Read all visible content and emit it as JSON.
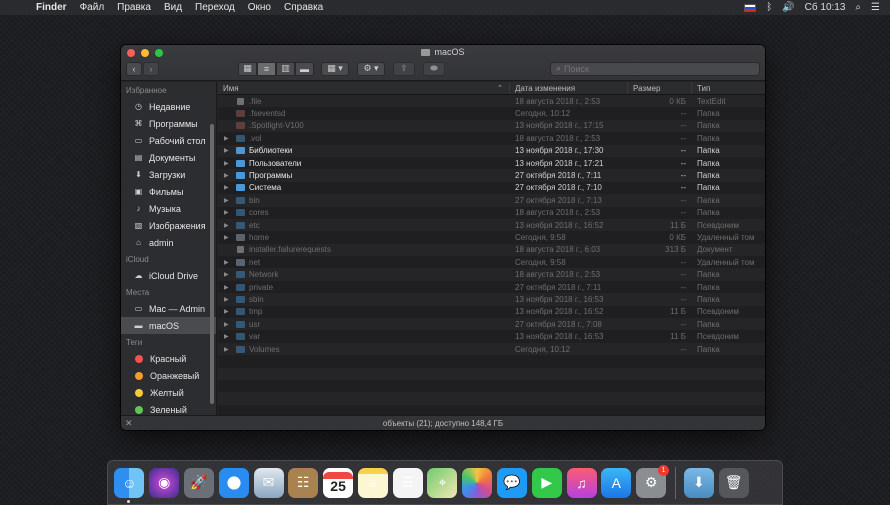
{
  "menubar": {
    "items": [
      "Finder",
      "Файл",
      "Правка",
      "Вид",
      "Переход",
      "Окно",
      "Справка"
    ],
    "clock": "Сб 10:13"
  },
  "window": {
    "title": "macOS",
    "search_placeholder": "Поиск",
    "status": "объекты (21); доступно 148,4 ГБ"
  },
  "sidebar": {
    "favorites_header": "Избранное",
    "favorites": [
      {
        "label": "Недавние",
        "icon": "recents-icon"
      },
      {
        "label": "Программы",
        "icon": "applications-icon"
      },
      {
        "label": "Рабочий стол",
        "icon": "desktop-icon"
      },
      {
        "label": "Документы",
        "icon": "documents-icon"
      },
      {
        "label": "Загрузки",
        "icon": "downloads-icon"
      },
      {
        "label": "Фильмы",
        "icon": "movies-icon"
      },
      {
        "label": "Музыка",
        "icon": "music-icon"
      },
      {
        "label": "Изображения",
        "icon": "pictures-icon"
      },
      {
        "label": "admin",
        "icon": "home-icon"
      }
    ],
    "icloud_header": "iCloud",
    "icloud": [
      {
        "label": "iCloud Drive",
        "icon": "cloud-icon"
      }
    ],
    "locations_header": "Места",
    "locations": [
      {
        "label": "Mac — Admin",
        "icon": "computer-icon"
      },
      {
        "label": "macOS",
        "icon": "disk-icon"
      }
    ],
    "tags_header": "Теги",
    "tags": [
      {
        "label": "Красный",
        "color": "#f0544c"
      },
      {
        "label": "Оранжевый",
        "color": "#f39c2b"
      },
      {
        "label": "Желтый",
        "color": "#f4cd32"
      },
      {
        "label": "Зеленый",
        "color": "#5fc853"
      }
    ]
  },
  "columns": {
    "name": "Имя",
    "date": "Дата изменения",
    "size": "Размер",
    "kind": "Тип"
  },
  "files": [
    {
      "name": ".file",
      "date": "18 августа 2018 г., 2:53",
      "size": "0 КБ",
      "kind": "TextEdit",
      "type": "file",
      "dim": true,
      "expand": false
    },
    {
      "name": ".fseventsd",
      "date": "Сегодня, 10:12",
      "size": "--",
      "kind": "Папка",
      "type": "folder-red",
      "dim": true,
      "expand": false
    },
    {
      "name": ".Spotlight-V100",
      "date": "13 ноября 2018 г., 17:15",
      "size": "--",
      "kind": "Папка",
      "type": "folder-red",
      "dim": true,
      "expand": false
    },
    {
      "name": ".vol",
      "date": "18 августа 2018 г., 2:53",
      "size": "--",
      "kind": "Папка",
      "type": "folder",
      "dim": true,
      "expand": true
    },
    {
      "name": "Библиотеки",
      "date": "13 ноября 2018 г., 17:30",
      "size": "--",
      "kind": "Папка",
      "type": "folder",
      "dim": false,
      "expand": true
    },
    {
      "name": "Пользователи",
      "date": "13 ноября 2018 г., 17:21",
      "size": "--",
      "kind": "Папка",
      "type": "folder",
      "dim": false,
      "expand": true
    },
    {
      "name": "Программы",
      "date": "27 октября 2018 г., 7:11",
      "size": "--",
      "kind": "Папка",
      "type": "folder",
      "dim": false,
      "expand": true
    },
    {
      "name": "Система",
      "date": "27 октября 2018 г., 7:10",
      "size": "--",
      "kind": "Папка",
      "type": "folder",
      "dim": false,
      "expand": true
    },
    {
      "name": "bin",
      "date": "27 октября 2018 г., 7:13",
      "size": "--",
      "kind": "Папка",
      "type": "folder",
      "dim": true,
      "expand": true
    },
    {
      "name": "cores",
      "date": "18 августа 2018 г., 2:53",
      "size": "--",
      "kind": "Папка",
      "type": "folder",
      "dim": true,
      "expand": true
    },
    {
      "name": "etc",
      "date": "13 ноября 2018 г., 16:52",
      "size": "11 Б",
      "kind": "Псевдоним",
      "type": "folder",
      "dim": true,
      "expand": true
    },
    {
      "name": "home",
      "date": "Сегодня, 9:58",
      "size": "0 КБ",
      "kind": "Удаленный том",
      "type": "alias",
      "dim": true,
      "expand": true
    },
    {
      "name": "installer.failurerequests",
      "date": "18 августа 2018 г., 6:03",
      "size": "313 Б",
      "kind": "Документ",
      "type": "file",
      "dim": true,
      "expand": false
    },
    {
      "name": "net",
      "date": "Сегодня, 9:58",
      "size": "--",
      "kind": "Удаленный том",
      "type": "alias",
      "dim": true,
      "expand": true
    },
    {
      "name": "Network",
      "date": "18 августа 2018 г., 2:53",
      "size": "--",
      "kind": "Папка",
      "type": "folder",
      "dim": true,
      "expand": true
    },
    {
      "name": "private",
      "date": "27 октября 2018 г., 7:11",
      "size": "--",
      "kind": "Папка",
      "type": "folder",
      "dim": true,
      "expand": true
    },
    {
      "name": "sbin",
      "date": "13 ноября 2018 г., 16:53",
      "size": "--",
      "kind": "Папка",
      "type": "folder",
      "dim": true,
      "expand": true
    },
    {
      "name": "tmp",
      "date": "13 ноября 2018 г., 16:52",
      "size": "11 Б",
      "kind": "Псевдоним",
      "type": "folder",
      "dim": true,
      "expand": true
    },
    {
      "name": "usr",
      "date": "27 октября 2018 г., 7:08",
      "size": "--",
      "kind": "Папка",
      "type": "folder",
      "dim": true,
      "expand": true
    },
    {
      "name": "var",
      "date": "13 ноября 2018 г., 16:53",
      "size": "11 Б",
      "kind": "Псевдоним",
      "type": "folder",
      "dim": true,
      "expand": true
    },
    {
      "name": "Volumes",
      "date": "Сегодня, 10:12",
      "size": "--",
      "kind": "Папка",
      "type": "folder",
      "dim": true,
      "expand": true
    }
  ],
  "dock": {
    "apps": [
      {
        "name": "finder-icon",
        "bg": "linear-gradient(90deg,#2f8ef0 50%,#6fc3f7 50%)",
        "glyph": "☺",
        "running": true
      },
      {
        "name": "siri-icon",
        "bg": "radial-gradient(circle,#d24be0,#3a2c8a)",
        "glyph": "◉"
      },
      {
        "name": "launchpad-icon",
        "bg": "#6b6f78",
        "glyph": "🚀"
      },
      {
        "name": "safari-icon",
        "bg": "radial-gradient(circle,#fff 30%,#2a8cf0 32%)",
        "glyph": "✦"
      },
      {
        "name": "mail-icon",
        "bg": "linear-gradient(#dfe8f0,#8aa6c0)",
        "glyph": "✉"
      },
      {
        "name": "contacts-icon",
        "bg": "#a9824f",
        "glyph": "☷"
      },
      {
        "name": "calendar-icon",
        "bg": "#ffffff",
        "glyph": "25"
      },
      {
        "name": "notes-icon",
        "bg": "linear-gradient(#f8d14a 20%,#fdf6d3 20%)",
        "glyph": "≡"
      },
      {
        "name": "reminders-icon",
        "bg": "#f4f4f4",
        "glyph": "☰"
      },
      {
        "name": "maps-icon",
        "bg": "linear-gradient(135deg,#6ecb6a,#f3e7b5)",
        "glyph": "⌖"
      },
      {
        "name": "photos-icon",
        "bg": "conic-gradient(#f4c542,#f07a3c,#d94c8a,#8a5cd6,#3d8ef0,#4ac46a,#f4c542)",
        "glyph": ""
      },
      {
        "name": "messages-icon",
        "bg": "#1e9cf5",
        "glyph": "💬"
      },
      {
        "name": "facetime-icon",
        "bg": "#34c84a",
        "glyph": "▶"
      },
      {
        "name": "itunes-icon",
        "bg": "linear-gradient(#fb5c74,#b740e0)",
        "glyph": "♫"
      },
      {
        "name": "appstore-icon",
        "bg": "linear-gradient(#3bb7f5,#1d75e8)",
        "glyph": "A"
      },
      {
        "name": "system-preferences-icon",
        "bg": "#8a8d92",
        "glyph": "⚙",
        "badge": "1"
      }
    ],
    "right": [
      {
        "name": "downloads-folder-icon",
        "bg": "linear-gradient(#7ab8e6,#4a8cc0)",
        "glyph": "⬇"
      },
      {
        "name": "trash-icon",
        "bg": "#55575b",
        "glyph": "🗑"
      }
    ]
  }
}
